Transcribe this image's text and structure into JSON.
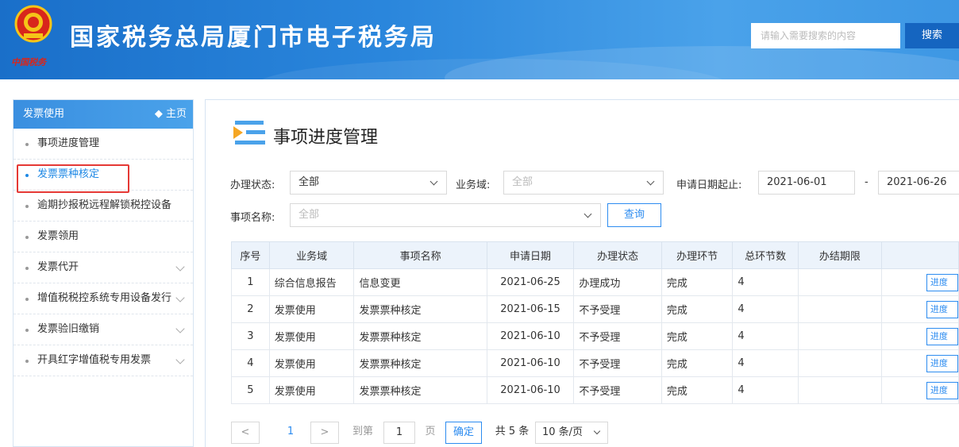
{
  "header": {
    "site_title": "国家税务总局厦门市电子税务局",
    "emblem_caption": "中国税务",
    "search_placeholder": "请输入需要搜索的内容",
    "search_button": "搜索"
  },
  "sidebar": {
    "section_title": "发票使用",
    "home_link": "◆ 主页",
    "items": [
      {
        "label": "事项进度管理",
        "expandable": false,
        "active": false
      },
      {
        "label": "发票票种核定",
        "expandable": false,
        "active": true
      },
      {
        "label": "逾期抄报税远程解锁税控设备",
        "expandable": false,
        "active": false
      },
      {
        "label": "发票领用",
        "expandable": false,
        "active": false
      },
      {
        "label": "发票代开",
        "expandable": true,
        "active": false
      },
      {
        "label": "增值税税控系统专用设备发行",
        "expandable": true,
        "active": false
      },
      {
        "label": "发票验旧缴销",
        "expandable": true,
        "active": false
      },
      {
        "label": "开具红字增值税专用发票",
        "expandable": true,
        "active": false
      }
    ]
  },
  "main": {
    "page_title": "事项进度管理",
    "filters": {
      "status_label": "办理状态:",
      "status_value": "全部",
      "domain_label": "业务域:",
      "domain_placeholder": "全部",
      "date_label": "申请日期起止:",
      "date_from": "2021-06-01",
      "date_sep": "-",
      "date_to": "2021-06-26",
      "item_label": "事项名称:",
      "item_placeholder": "全部",
      "query_button": "查询"
    },
    "table": {
      "columns": [
        "序号",
        "业务域",
        "事项名称",
        "申请日期",
        "办理状态",
        "办理环节",
        "总环节数",
        "办结期限",
        ""
      ],
      "rows": [
        {
          "no": "1",
          "domain": "综合信息报告",
          "item": "信息变更",
          "date": "2021-06-25",
          "status": "办理成功",
          "step": "完成",
          "total": "4",
          "deadline": "",
          "action": "进度"
        },
        {
          "no": "2",
          "domain": "发票使用",
          "item": "发票票种核定",
          "date": "2021-06-15",
          "status": "不予受理",
          "step": "完成",
          "total": "4",
          "deadline": "",
          "action": "进度"
        },
        {
          "no": "3",
          "domain": "发票使用",
          "item": "发票票种核定",
          "date": "2021-06-10",
          "status": "不予受理",
          "step": "完成",
          "total": "4",
          "deadline": "",
          "action": "进度"
        },
        {
          "no": "4",
          "domain": "发票使用",
          "item": "发票票种核定",
          "date": "2021-06-10",
          "status": "不予受理",
          "step": "完成",
          "total": "4",
          "deadline": "",
          "action": "进度"
        },
        {
          "no": "5",
          "domain": "发票使用",
          "item": "发票票种核定",
          "date": "2021-06-10",
          "status": "不予受理",
          "step": "完成",
          "total": "4",
          "deadline": "",
          "action": "进度"
        }
      ]
    },
    "pagination": {
      "prev": "<",
      "current_page": "1",
      "next": ">",
      "goto_label": "到第",
      "goto_value": "1",
      "page_unit": "页",
      "confirm": "确定",
      "total_text": "共 5 条",
      "page_size": "10 条/页"
    }
  },
  "colors": {
    "header_blue": "#2a86dc",
    "accent": "#2d8cf0",
    "highlight_red": "#e53935"
  }
}
